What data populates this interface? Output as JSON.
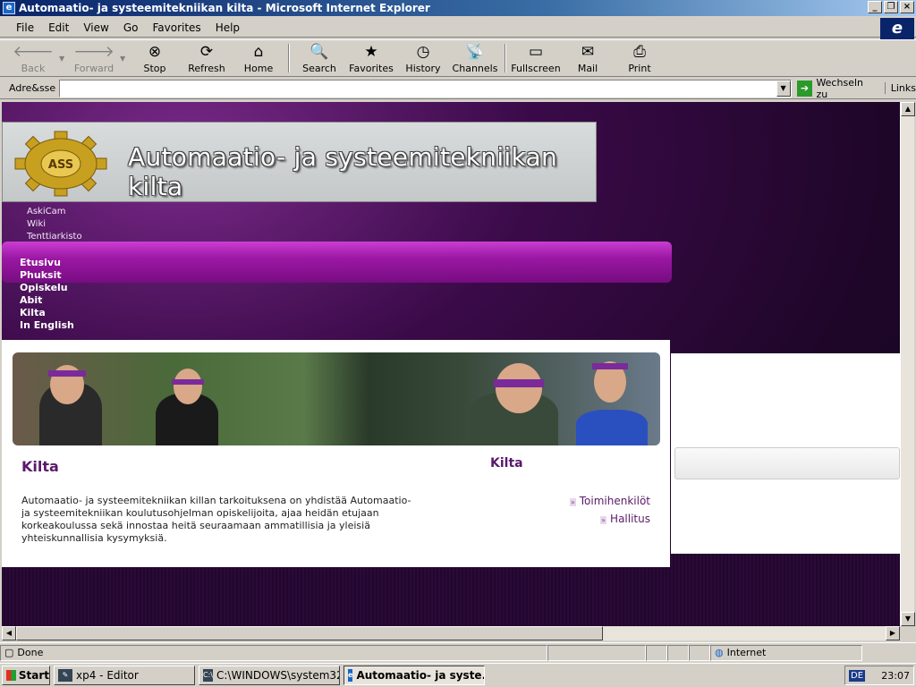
{
  "window": {
    "title": "Automaatio- ja systeemitekniikan kilta - Microsoft Internet Explorer"
  },
  "menu": [
    "File",
    "Edit",
    "View",
    "Go",
    "Favorites",
    "Help"
  ],
  "toolbar": {
    "back": "Back",
    "forward": "Forward",
    "stop": "Stop",
    "refresh": "Refresh",
    "home": "Home",
    "search": "Search",
    "favorites": "Favorites",
    "history": "History",
    "channels": "Channels",
    "fullscreen": "Fullscreen",
    "mail": "Mail",
    "print": "Print"
  },
  "address": {
    "label": "Adre&sse",
    "value": "",
    "go": "Wechseln zu",
    "links": "Links"
  },
  "site": {
    "title": "Automaatio- ja systeemitekniikan kilta",
    "toplinks": [
      "AskiCam",
      "Wiki",
      "Tenttiarkisto"
    ],
    "nav": [
      "Etusivu",
      "Phuksit",
      "Opiskelu",
      "Abit",
      "Kilta",
      "In English"
    ],
    "heading": "Kilta",
    "intro": "Automaatio- ja systeemitekniikan killan tarkoituksena on yhdistää Automaatio- ja systeemitekniikan koulutusohjelman opiskelijoita, ajaa heidän etujaan korkeakoulussa sekä innostaa heitä seuraamaan ammatillisia ja yleisiä yhteiskunnallisia kysymyksiä.",
    "side_heading": "Kilta",
    "side_links": [
      "Toimihenkilöt",
      "Hallitus"
    ]
  },
  "status": {
    "text": "Done",
    "zone": "Internet"
  },
  "taskbar": {
    "start": "Start",
    "tasks": [
      "xp4 - Editor",
      "C:\\WINDOWS\\system32...",
      "Automaatio- ja syste..."
    ],
    "lang": "DE",
    "clock": "23:07"
  }
}
